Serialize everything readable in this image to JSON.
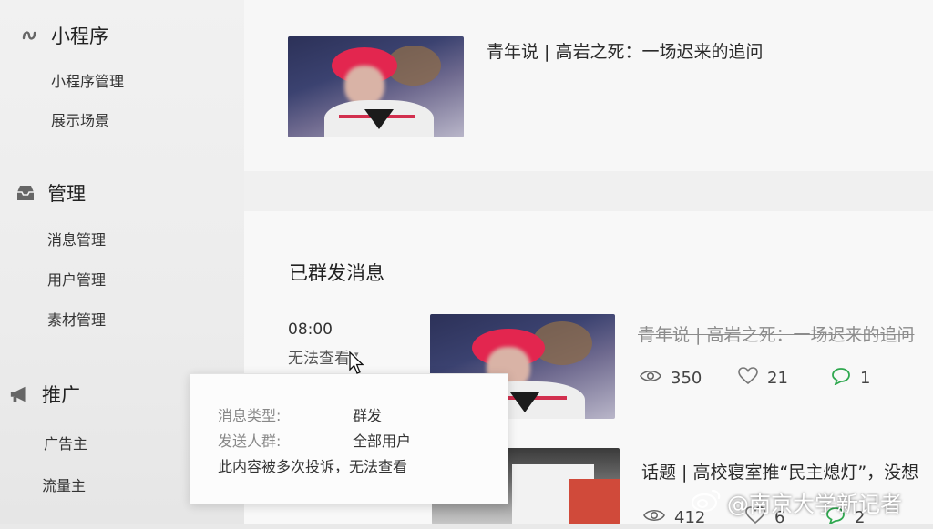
{
  "sidebar": {
    "miniprogram": {
      "label": "小程序",
      "items": [
        "小程序管理",
        "展示场景"
      ]
    },
    "manage": {
      "label": "管理",
      "items": [
        "消息管理",
        "用户管理",
        "素材管理"
      ]
    },
    "promote": {
      "label": "推广",
      "items": [
        "广告主",
        "流量主"
      ]
    }
  },
  "top_article": {
    "title": "青年说 | 高岩之死：一场迟来的追问"
  },
  "sent_section": {
    "title": "已群发消息",
    "items": [
      {
        "time": "08:00",
        "status": "无法查看",
        "title": "青年说 | 高岩之死：一场迟来的追问",
        "reads": "350",
        "likes": "21",
        "comments": "1"
      },
      {
        "title": "话题 | 高校寝室推“民主熄灯”，没想",
        "reads": "412",
        "likes": "6",
        "comments": "2"
      }
    ]
  },
  "tooltip": {
    "type_label": "消息类型:",
    "type_value": "群发",
    "audience_label": "发送人群:",
    "audience_value": "全部用户",
    "notice": "此内容被多次投诉，无法查看"
  },
  "watermark": {
    "text": "@南京大学新记者"
  },
  "colors": {
    "comment_icon": "#2fa84f",
    "hat": "#e3264f"
  }
}
